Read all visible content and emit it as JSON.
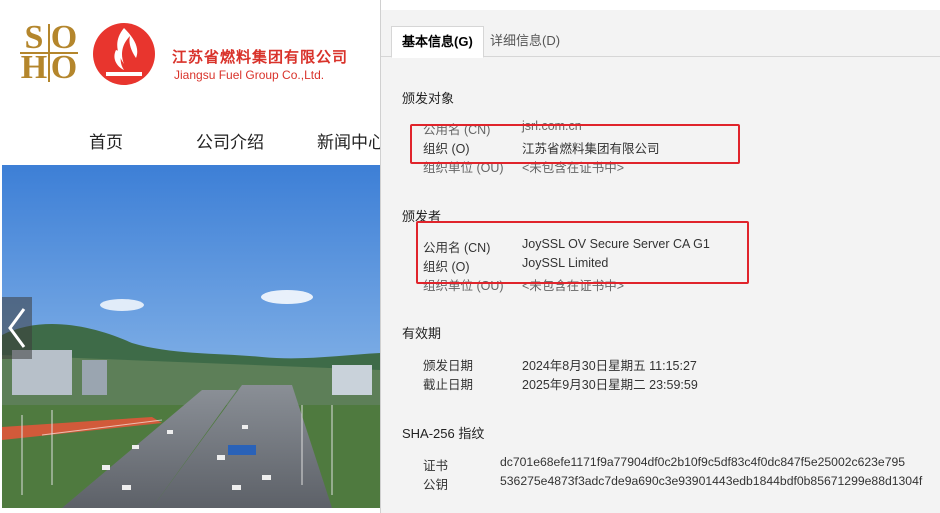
{
  "site": {
    "logo_letters": [
      "S",
      "O",
      "H",
      "O"
    ],
    "brand_name_cn": "江苏省燃料集团有限公司",
    "brand_name_en": "Jiangsu Fuel Group Co.,Ltd.",
    "nav": [
      "首页",
      "公司介绍",
      "新闻中心"
    ],
    "brand_color": "#d9332b",
    "logo_color": "#b4862c"
  },
  "panel": {
    "tabs": [
      {
        "label": "基本信息(G)",
        "active": true
      },
      {
        "label": "详细信息(D)",
        "active": false
      }
    ],
    "subject": {
      "title": "颁发对象",
      "fields": [
        {
          "label": "公用名 (CN)",
          "value": "jsrl.com.cn"
        },
        {
          "label": "组织 (O)",
          "value": "江苏省燃料集团有限公司"
        },
        {
          "label": "组织单位 (OU)",
          "value": "<未包含在证书中>"
        }
      ]
    },
    "issuer": {
      "title": "颁发者",
      "fields": [
        {
          "label": "公用名 (CN)",
          "value": "JoySSL OV Secure Server CA G1"
        },
        {
          "label": "组织 (O)",
          "value": "JoySSL Limited"
        },
        {
          "label": "组织单位 (OU)",
          "value": "<未包含在证书中>"
        }
      ]
    },
    "validity": {
      "title": "有效期",
      "fields": [
        {
          "label": "颁发日期",
          "value": "2024年8月30日星期五 11:15:27"
        },
        {
          "label": "截止日期",
          "value": "2025年9月30日星期二 23:59:59"
        }
      ]
    },
    "fingerprint": {
      "title": "SHA-256 指纹",
      "fields": [
        {
          "label": "证书",
          "value": "dc701e68efe1171f9a77904df0c2b10f9c5df83c4f0dc847f5e25002c623e795"
        },
        {
          "label": "公钥",
          "value": "536275e4873f3adc7de9a690c3e93901443edb1844bdf0b85671299e88d1304f"
        }
      ]
    },
    "highlight_color": "#e0242b"
  }
}
